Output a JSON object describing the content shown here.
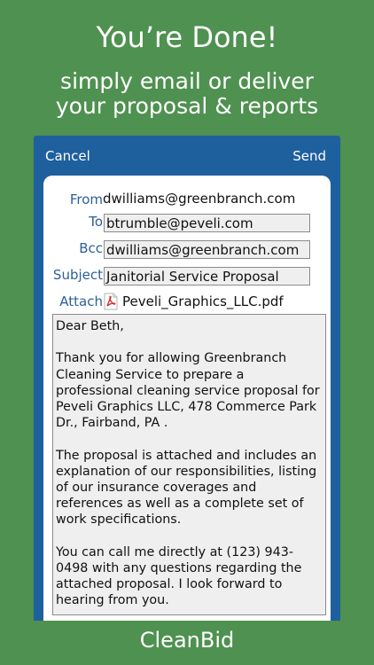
{
  "promo": {
    "headline": "You’re Done!",
    "subline": "simply email or deliver\nyour proposal & reports"
  },
  "nav": {
    "cancel_label": "Cancel",
    "send_label": "Send"
  },
  "compose": {
    "from_label": "From",
    "from_value": "dwilliams@greenbranch.com",
    "to_label": "To",
    "to_value": "btrumble@peveli.com",
    "bcc_label": "Bcc",
    "bcc_value": "dwilliams@greenbranch.com",
    "subject_label": "Subject",
    "subject_value": "Janitorial Service Proposal",
    "attach_label": "Attach",
    "attachment_name": "Peveli_Graphics_LLC.pdf",
    "attachment_icon": "pdf-file-icon",
    "body": [
      "Dear Beth,",
      "Thank you for allowing Greenbranch Cleaning Service to prepare a professional cleaning service proposal for Peveli Graphics LLC, 478 Commerce Park Dr., Fairband, PA .",
      "The proposal is attached and includes an explanation of our responsibilities, listing of our insurance coverages and references as well as a complete set of work specifications.",
      "You can call me directly at (123) 943-0498 with any questions regarding the attached proposal. I look forward to hearing from you."
    ]
  },
  "footer": {
    "brand": "CleanBid"
  },
  "colors": {
    "background": "#4f9150",
    "navbar": "#1e5f9e",
    "label": "#2b5f98",
    "pdf": "#d32f2f"
  }
}
